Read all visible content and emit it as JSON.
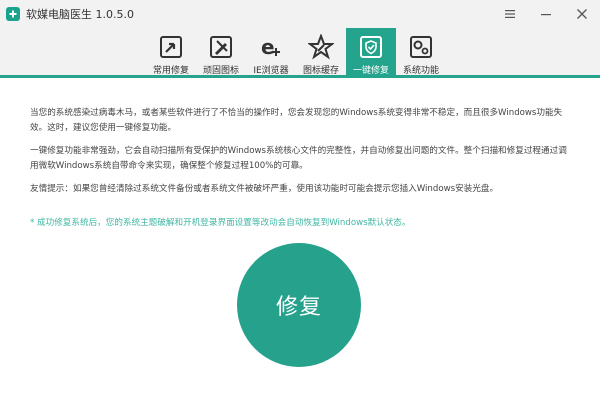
{
  "window": {
    "title": "软媒电脑医生 1.0.5.0"
  },
  "tabs": [
    {
      "label": "常用修复",
      "icon": "wrench-arrow-icon"
    },
    {
      "label": "顽固图标",
      "icon": "pencil-wrench-icon"
    },
    {
      "label": "IE浏览器",
      "icon": "ie-plus-icon"
    },
    {
      "label": "图标缓存",
      "icon": "star-wrench-icon"
    },
    {
      "label": "一键修复",
      "icon": "shield-repair-icon",
      "active": true
    },
    {
      "label": "系统功能",
      "icon": "gears-icon"
    }
  ],
  "content": {
    "para1": "当您的系统感染过病毒木马，或者某些软件进行了不恰当的操作时，您会发现您的Windows系统变得非常不稳定，而且很多Windows功能失效。这时，建议您使用一键修复功能。",
    "para2": "一键修复功能非常强劲，它会自动扫描所有受保护的Windows系统核心文件的完整性，并自动修复出问题的文件。整个扫描和修复过程通过调用微软Windows系统自带命令来实现，确保整个修复过程100%的可靠。",
    "para3": "友情提示：如果您曾经清除过系统文件备份或者系统文件被破坏严重，使用该功能时可能会提示您插入Windows安装光盘。",
    "note": "* 成功修复系统后，您的系统主题破解和开机登录界面设置等改动会自动恢复到Windows默认状态。"
  },
  "repair_button": {
    "label": "修复"
  },
  "colors": {
    "accent": "#24a38d",
    "note": "#3fb7a3"
  }
}
